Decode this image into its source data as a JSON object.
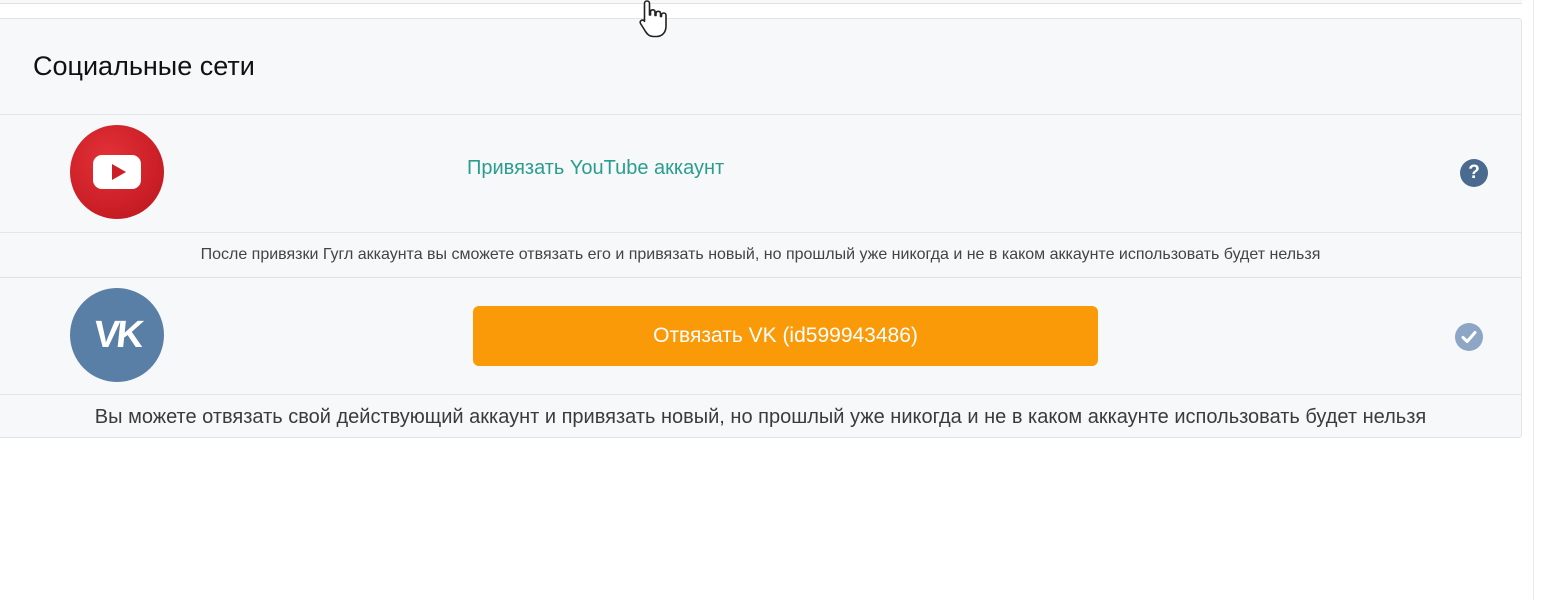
{
  "section": {
    "title": "Социальные сети"
  },
  "youtube": {
    "logo_icon": "youtube-logo-icon",
    "link_label": "Привязать YouTube аккаунт",
    "help_icon": "question-icon",
    "help_glyph": "?",
    "note": "После привязки Гугл аккаунта вы сможете отвязать его и привязать новый, но прошлый уже никогда и не в каком аккаунте использовать будет нельзя",
    "link_color": "#2a9d8f",
    "logo_color": "#cc1f27"
  },
  "vk": {
    "logo_icon": "vk-logo-icon",
    "logo_text": "VK",
    "button_label": "Отвязать VK (id599943486)",
    "status_icon": "checkmark-icon",
    "note": "Вы можете отвязать свой действующий аккаунт и привязать новый, но прошлый уже никогда и не в каком аккаунте использовать будет нельзя",
    "button_color": "#fb9a08",
    "logo_color": "#5a7fa6"
  },
  "cursor": {
    "icon": "hand-pointer-cursor-icon"
  }
}
